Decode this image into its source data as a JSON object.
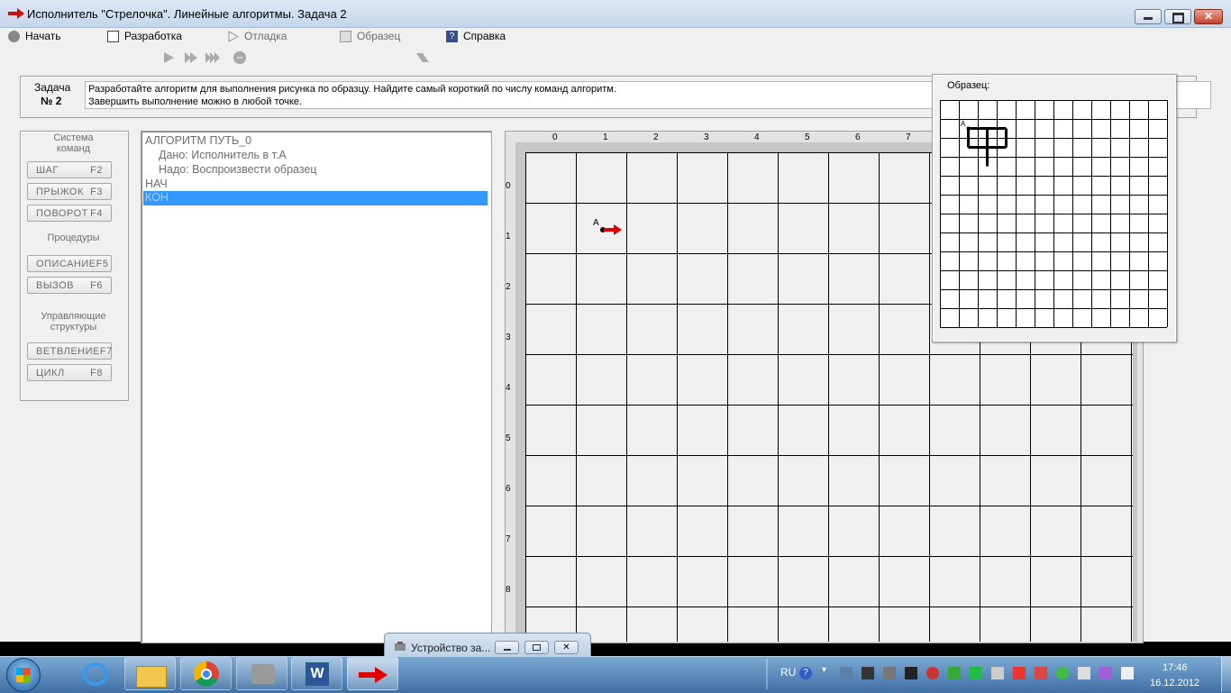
{
  "window": {
    "title": "Исполнитель \"Стрелочка\".  Линейные алгоритмы.  Задача  2"
  },
  "menu": {
    "items": [
      {
        "label": "Начать",
        "icon": "start-icon",
        "enabled": true
      },
      {
        "label": "Разработка",
        "icon": "develop-icon",
        "enabled": true
      },
      {
        "label": "Отладка",
        "icon": "debug-icon",
        "enabled": false
      },
      {
        "label": "Образец",
        "icon": "sample-icon",
        "enabled": false
      },
      {
        "label": "Справка",
        "icon": "help-icon",
        "enabled": true
      }
    ]
  },
  "task": {
    "label": "Задача",
    "number": "№ 2",
    "line1": "Разработайте алгоритм для выполнения рисунка по образцу. Найдите самый короткий по числу команд алгоритм.",
    "line2": "Завершить выполнение можно в любой точке."
  },
  "commands": {
    "group1": "Система команд",
    "step": {
      "label": "ШАГ",
      "key": "F2"
    },
    "jump": {
      "label": "ПРЫЖОК",
      "key": "F3"
    },
    "turn": {
      "label": "ПОВОРОТ",
      "key": "F4"
    },
    "group2": "Процедуры",
    "describe": {
      "label": "ОПИСАНИЕ",
      "key": "F5"
    },
    "call": {
      "label": "ВЫЗОВ",
      "key": "F6"
    },
    "group3": "Управляющие структуры",
    "branch": {
      "label": "ВЕТВЛЕНИЕ",
      "key": "F7"
    },
    "loop": {
      "label": "ЦИКЛ",
      "key": "F8"
    }
  },
  "algorithm": {
    "lines": [
      "АЛГОРИТМ ПУТЬ_0",
      "Дано: Исполнитель в т.А",
      "Надо: Воспроизвести образец",
      "НАЧ",
      "КОН"
    ]
  },
  "field": {
    "columns": [
      "0",
      "1",
      "2",
      "3",
      "4",
      "5",
      "6",
      "7"
    ],
    "rows": [
      "0",
      "1",
      "2",
      "3",
      "4",
      "5",
      "6",
      "7",
      "8"
    ],
    "start_label": "A",
    "arrow_color": "#e00000"
  },
  "sample": {
    "label": "Образец:",
    "start_label": "A"
  },
  "device_dialog": {
    "title": "Устройство за..."
  },
  "taskbar": {
    "lang": "RU",
    "time": "17:46",
    "date": "16.12.2012"
  }
}
